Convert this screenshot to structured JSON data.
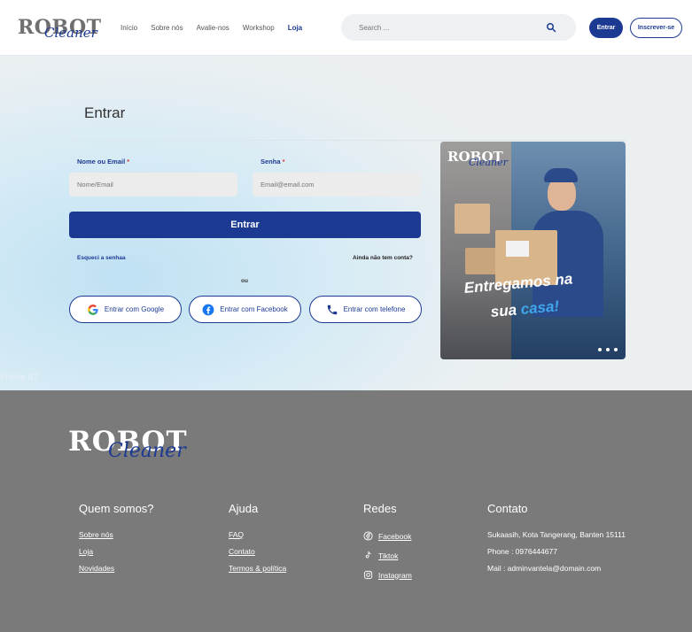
{
  "header": {
    "logo": {
      "word1": "ROBOT",
      "word2": "Cleaner"
    },
    "nav": [
      "Início",
      "Sobre nós",
      "Avalie-nos",
      "Workshop",
      "Loja"
    ],
    "nav_active": "Loja",
    "search_placeholder": "Search ...",
    "login_label": "Entrar",
    "signup_label": "Inscrever-se"
  },
  "login": {
    "title": "Entrar",
    "email_label": "Nome ou Email",
    "email_placeholder": "Nome/Email",
    "password_label": "Senha",
    "password_placeholder": "Email@email.com",
    "required_mark": "*",
    "submit_label": "Entrar",
    "forgot_label": "Esqueci a senhaa",
    "no_account_label": "Ainda não tem conta?",
    "or_label": "ou",
    "social": [
      {
        "label": "Entrar com Google",
        "icon": "google-icon"
      },
      {
        "label": "Entrar com Facebook",
        "icon": "facebook-icon"
      },
      {
        "label": "Entrar com telefone",
        "icon": "phone-icon"
      }
    ]
  },
  "promo": {
    "logo": {
      "word1": "ROBOT",
      "word2": "Cleaner"
    },
    "headline_line1": "Entregamos na",
    "headline_line2_a": "sua ",
    "headline_line2_b": "casa!",
    "slide_count": 3
  },
  "frame_label": "Frame 87",
  "footer": {
    "logo": {
      "word1": "ROBOT",
      "word2": "Cleaner"
    },
    "about": {
      "title": "Quem somos?",
      "links": [
        "Sobre nós",
        "Loja",
        "Novidades"
      ]
    },
    "help": {
      "title": "Ajuda",
      "links": [
        "FAQ",
        "Contato",
        "Termos & política"
      ]
    },
    "social": {
      "title": "Redes",
      "links": [
        {
          "label": "Facebook",
          "icon": "facebook-icon"
        },
        {
          "label": "Tiktok",
          "icon": "tiktok-icon"
        },
        {
          "label": "Instagram",
          "icon": "instagram-icon"
        }
      ]
    },
    "contact": {
      "title": "Contato",
      "lines": [
        "Sukaasih, Kota Tangerang, Banten 15111",
        "Phone : 0976444677",
        "Mail : adminvantela@domain.com"
      ]
    }
  },
  "colors": {
    "brand_blue": "#1d3a93",
    "accent_blue": "#3fa6ec",
    "footer_bg": "#7a7a7a",
    "required_red": "#d23b3b"
  }
}
